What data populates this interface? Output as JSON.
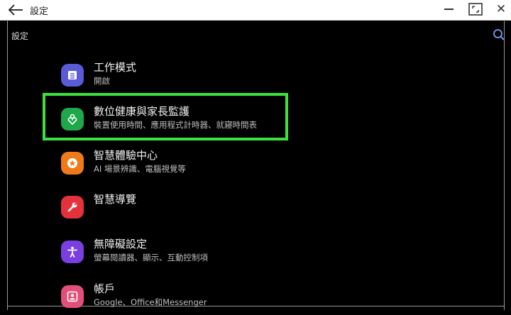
{
  "window": {
    "title": "設定"
  },
  "page": {
    "label": "設定"
  },
  "menu": [
    {
      "title": "工作模式",
      "subtitle": "開啟",
      "icon": "work-mode-icon",
      "color": "#5b5bd6"
    },
    {
      "title": "數位健康與家長監護",
      "subtitle": "裝置使用時間、應用程式計時器、就寢時間表",
      "icon": "digital-wellbeing-icon",
      "color": "#1fa84b"
    },
    {
      "title": "智慧體驗中心",
      "subtitle": "AI 場景辨識、電腦視覺等",
      "icon": "star-icon",
      "color": "#f07a1a"
    },
    {
      "title": "智慧導覽",
      "subtitle": "",
      "icon": "wrench-icon",
      "color": "#e3323b"
    },
    {
      "title": "無障礙設定",
      "subtitle": "螢幕閱讀器、顯示、互動控制項",
      "icon": "accessibility-icon",
      "color": "#7a3fe0"
    },
    {
      "title": "帳戶",
      "subtitle": "Google、Office和Messenger",
      "icon": "account-icon",
      "color": "#e24f7b"
    }
  ],
  "highlight_color": "#3ce13c"
}
